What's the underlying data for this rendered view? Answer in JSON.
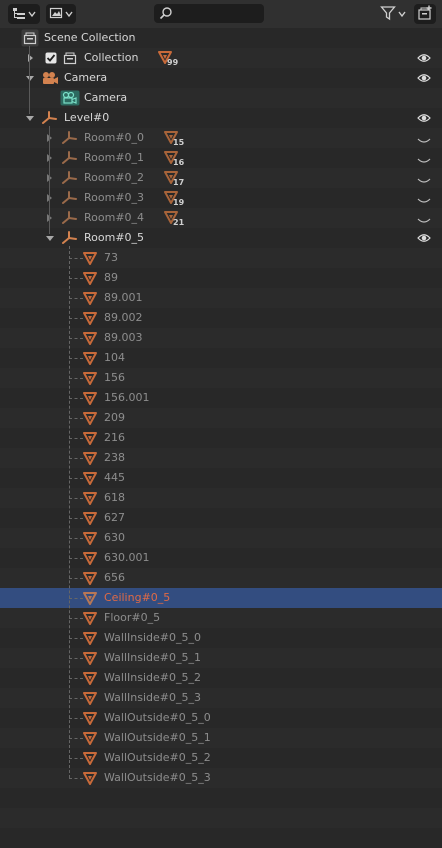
{
  "header": {
    "display_mode_icon": "outliner-display-mode-icon",
    "view_filter_icon": "image-view-icon",
    "search": {
      "placeholder": "",
      "value": ""
    },
    "filter_icon": "funnel-icon",
    "new_collection_icon": "new-collection-icon"
  },
  "tree": {
    "scene_collection": "Scene Collection",
    "collection": {
      "label": "Collection",
      "checked": true,
      "badge": "99"
    },
    "camera_object": "Camera",
    "camera_data": "Camera",
    "level": "Level#0",
    "rooms": [
      {
        "label": "Room#0_0",
        "badge": "15"
      },
      {
        "label": "Room#0_1",
        "badge": "16"
      },
      {
        "label": "Room#0_2",
        "badge": "17"
      },
      {
        "label": "Room#0_3",
        "badge": "19"
      },
      {
        "label": "Room#0_4",
        "badge": "21"
      }
    ],
    "room_expanded": "Room#0_5",
    "meshes": [
      "73",
      "89",
      "89.001",
      "89.002",
      "89.003",
      "104",
      "156",
      "156.001",
      "209",
      "216",
      "238",
      "445",
      "618",
      "627",
      "630",
      "630.001",
      "656",
      "Ceiling#0_5",
      "Floor#0_5",
      "WallInside#0_5_0",
      "WallInside#0_5_1",
      "WallInside#0_5_2",
      "WallInside#0_5_3",
      "WallOutside#0_5_0",
      "WallOutside#0_5_1",
      "WallOutside#0_5_2",
      "WallOutside#0_5_3"
    ],
    "selected_mesh": "Ceiling#0_5"
  },
  "colors": {
    "selection": "#334d80",
    "mesh_orange": "#c86a3a",
    "camera_teal": "#3aa38f"
  }
}
